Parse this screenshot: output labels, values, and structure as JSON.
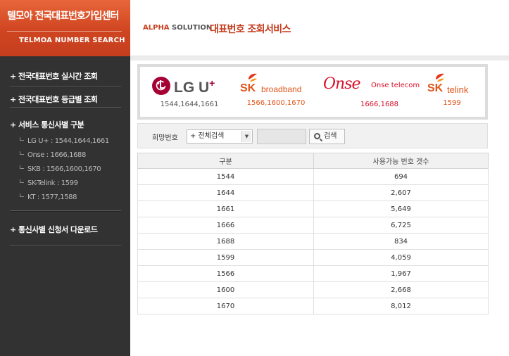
{
  "sidebar": {
    "brand_title": "텔모아 전국대표번호가입센터",
    "brand_sub": "TELMOA NUMBER SEARCH",
    "menu": [
      {
        "label": "+ 전국대표번호 실시간 조회"
      },
      {
        "label": "+ 전국대표번호 등급별 조회"
      },
      {
        "label": "+ 서비스 통신사별 구분"
      }
    ],
    "sub_items": [
      {
        "label": "LG U+ : 1544,1644,1661"
      },
      {
        "label": "Onse : 1666,1688"
      },
      {
        "label": "SKB : 1566,1600,1670"
      },
      {
        "label": "SK-Telink : 1599"
      },
      {
        "label": "KT : 1577,1588"
      }
    ],
    "download": "+ 통신사별 신청서 다운로드"
  },
  "header": {
    "crumb_alpha": "ALPHA",
    "crumb_solution": "SOLUTION",
    "title": "대표번호 조회서비스"
  },
  "carriers": [
    {
      "logo_lg": "LG U",
      "logo_plus": "+",
      "numbers": "1544,1644,1661",
      "color": "#a50034"
    },
    {
      "logo_sk": "SK",
      "logo_name": "broadband",
      "numbers": "1566,1600,1670",
      "color": "#e2561b"
    },
    {
      "logo_onse": "Onse",
      "logo_name": "Onse telecom",
      "numbers": "1666,1688",
      "color": "#d8102a"
    },
    {
      "logo_sk": "SK",
      "logo_name": "telink",
      "numbers": "1599",
      "color": "#e2561b"
    }
  ],
  "search": {
    "label": "희망번호",
    "select_value": "+ 전체검색",
    "input_value": "",
    "button_label": "검색"
  },
  "table": {
    "headers": [
      "구분",
      "사용가능 번호 갯수"
    ],
    "rows": [
      [
        "1544",
        "694"
      ],
      [
        "1644",
        "2,607"
      ],
      [
        "1661",
        "5,649"
      ],
      [
        "1666",
        "6,725"
      ],
      [
        "1688",
        "834"
      ],
      [
        "1599",
        "4,059"
      ],
      [
        "1566",
        "1,967"
      ],
      [
        "1600",
        "2,668"
      ],
      [
        "1670",
        "8,012"
      ]
    ]
  },
  "colors": {
    "brand": "#cf4521",
    "sidebar": "#323232",
    "title_red": "#c43a1b"
  }
}
